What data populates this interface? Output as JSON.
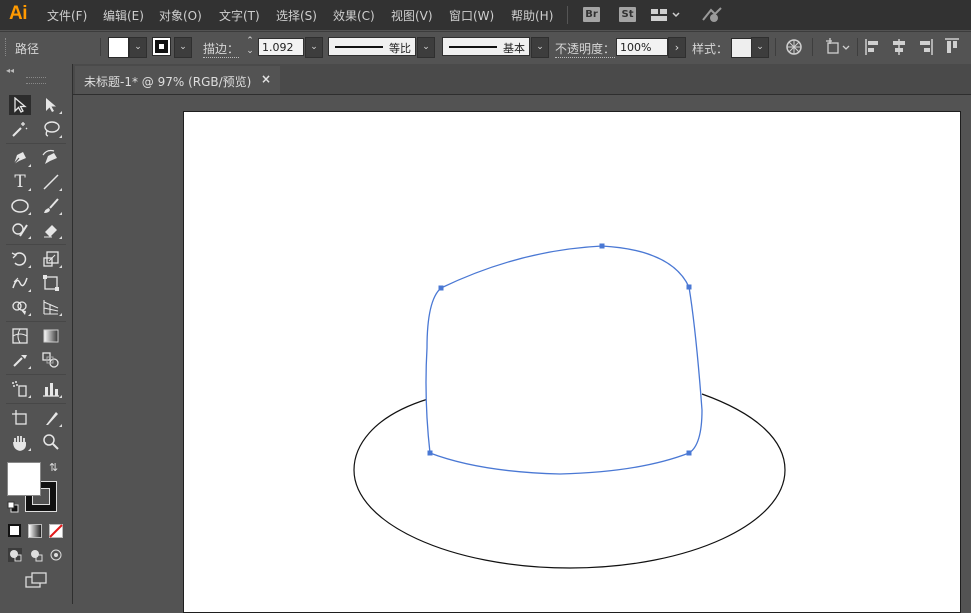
{
  "app": {
    "logo": "Ai"
  },
  "menu": [
    "文件(F)",
    "编辑(E)",
    "对象(O)",
    "文字(T)",
    "选择(S)",
    "效果(C)",
    "视图(V)",
    "窗口(W)",
    "帮助(H)"
  ],
  "bridge_buttons": {
    "br": "Br",
    "st": "St"
  },
  "control_bar": {
    "selection_type": "路径",
    "stroke_label": "描边：",
    "stroke_weight": "1.092",
    "stroke_profile": "等比",
    "brush": "基本",
    "opacity_label": "不透明度：",
    "opacity_value": "100%",
    "style_label": "样式："
  },
  "document": {
    "tab_title": "未标题-1* @ 97% (RGB/预览)",
    "close_glyph": "×"
  },
  "colors": {
    "selection_blue": "#4a78d4",
    "canvas_bg": "#535353",
    "artboard": "#ffffff",
    "menubar_bg": "#323232",
    "logo": "#ff9a00"
  },
  "tools": [
    "selection-tool",
    "direct-selection-tool",
    "magic-wand-tool",
    "lasso-tool",
    "pen-tool",
    "curvature-tool",
    "type-tool",
    "line-segment-tool",
    "ellipse-tool",
    "paintbrush-tool",
    "shaper-tool",
    "eraser-tool",
    "rotate-tool",
    "scale-tool",
    "width-tool",
    "free-transform-tool",
    "shape-builder-tool",
    "perspective-grid-tool",
    "mesh-tool",
    "gradient-tool",
    "eyedropper-tool",
    "blend-tool",
    "symbol-sprayer-tool",
    "column-graph-tool",
    "artboard-tool",
    "slice-tool",
    "hand-tool",
    "zoom-tool"
  ]
}
